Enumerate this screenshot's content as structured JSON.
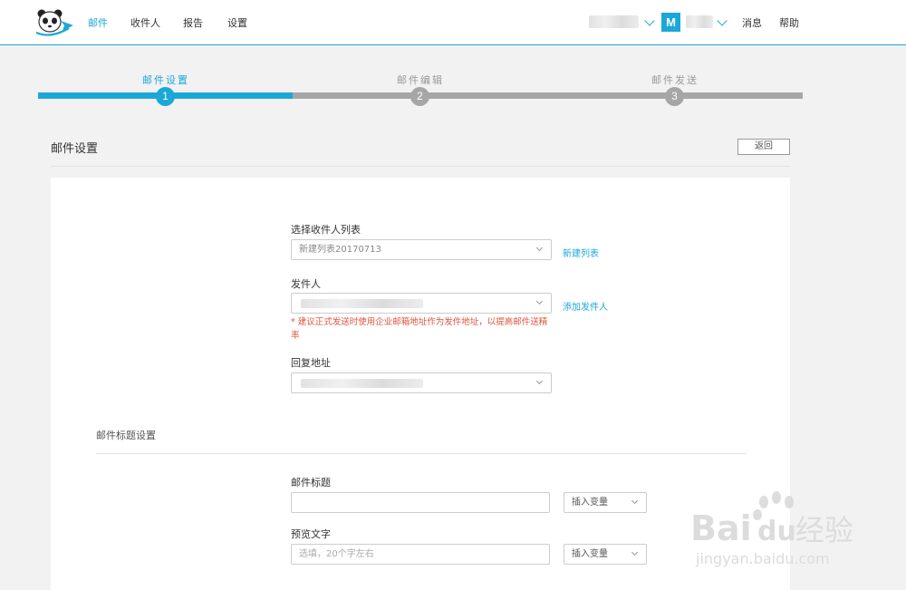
{
  "header": {
    "nav": [
      "邮件",
      "收件人",
      "报告",
      "设置"
    ],
    "account_initial": "M",
    "messages": "消息",
    "help": "帮助"
  },
  "steps": [
    {
      "label": "邮件设置",
      "number": "1",
      "state": "active"
    },
    {
      "label": "邮件编辑",
      "number": "2",
      "state": "inactive"
    },
    {
      "label": "邮件发送",
      "number": "3",
      "state": "inactive"
    }
  ],
  "page": {
    "title": "邮件设置",
    "back_label": "返回"
  },
  "form": {
    "recipient_list_label": "选择收件人列表",
    "recipient_list_value": "新建列表20170713",
    "new_list_link": "新建列表",
    "sender_label": "发件人",
    "add_sender_link": "添加发件人",
    "sender_warning": "* 建议正式发送时使用企业邮箱地址作为发件地址，以提高邮件送精率",
    "reply_label": "回复地址",
    "subject_section": "邮件标题设置",
    "subject_label": "邮件标题",
    "subject_value": "",
    "insert_var_label": "插入变量",
    "preview_label": "预览文字",
    "preview_placeholder": "选填，20个字左右",
    "insert_var_label_2": "插入变量"
  },
  "watermark": {
    "brand": "Bai",
    "brand_suffix": "du",
    "brand_cn": "经验",
    "url": "jingyan.baidu.com"
  },
  "colors": {
    "accent": "#1ba8d8",
    "inactive_step": "#a6a6a6",
    "warning": "#e0533d"
  }
}
